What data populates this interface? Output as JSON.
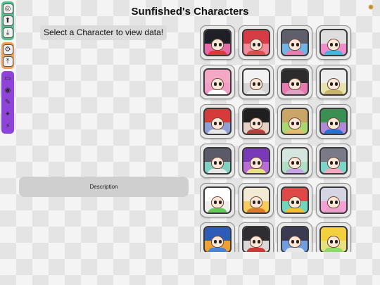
{
  "header": {
    "title": "Sunfished's Characters",
    "settings_icon": "gear-icon"
  },
  "prompt": {
    "text": "Select a Character to view data!"
  },
  "description": {
    "label": "Description"
  },
  "colors": {
    "toolbar_green": "#58bd8c",
    "toolbar_orange": "#f0a050",
    "toolbar_purple": "#8e44d8",
    "settings_gold": "#c48b20"
  },
  "toolbar": {
    "groups": [
      {
        "color": "toolbar_green",
        "items": [
          {
            "icon": "ring-icon",
            "glyph": "◎"
          },
          {
            "icon": "arrow-up-icon",
            "glyph": "⬆"
          },
          {
            "icon": "download-icon",
            "glyph": "⤓"
          }
        ]
      },
      {
        "color": "toolbar_orange",
        "items": [
          {
            "icon": "settings-icon",
            "glyph": "⚙"
          },
          {
            "icon": "up-icon",
            "glyph": "⤒"
          }
        ]
      },
      {
        "color": "toolbar_purple",
        "items": [
          {
            "icon": "frame-icon",
            "glyph": "▭"
          },
          {
            "icon": "color-icon",
            "glyph": "◉"
          },
          {
            "icon": "brush-icon",
            "glyph": "✎"
          },
          {
            "icon": "sparkle-icon",
            "glyph": "✦"
          },
          {
            "icon": "magic-icon",
            "glyph": "⚡"
          }
        ]
      }
    ]
  },
  "characters": [
    {
      "name": "character-1",
      "bg": "#e86aa8",
      "hair": "#1f1f27",
      "outfit": "#d93a3a"
    },
    {
      "name": "character-2",
      "bg": "#f28b9a",
      "hair": "#d73c45",
      "outfit": "#d65050"
    },
    {
      "name": "character-3",
      "bg": "#6fb5e8",
      "hair": "#5f5f6b",
      "outfit": "#e27fb0"
    },
    {
      "name": "character-4",
      "bg": "#f08ccc",
      "hair": "#dedede",
      "outfit": "#42b6d6"
    },
    {
      "name": "character-5",
      "bg": "#f39cc7",
      "hair": "#f5a8c6",
      "outfit": "#ffffff"
    },
    {
      "name": "character-6",
      "bg": "#d6d6d6",
      "hair": "#f2f2f2",
      "outfit": "#e8e8e8"
    },
    {
      "name": "character-7",
      "bg": "#e87aaf",
      "hair": "#2c2c2c",
      "outfit": "#e2a0c4"
    },
    {
      "name": "character-8",
      "bg": "#e7e3b0",
      "hair": "#ececec",
      "outfit": "#c8b36d"
    },
    {
      "name": "character-9",
      "bg": "#8ea0d6",
      "hair": "#d63a3a",
      "outfit": "#e8e8e8"
    },
    {
      "name": "character-10",
      "bg": "#e5d0c4",
      "hair": "#1f1f1f",
      "outfit": "#b44040"
    },
    {
      "name": "character-11",
      "bg": "#a8d86f",
      "hair": "#caa568",
      "outfit": "#e2bc77"
    },
    {
      "name": "character-12",
      "bg": "#b08ad8",
      "hair": "#3a8f52",
      "outfit": "#2c6ed0"
    },
    {
      "name": "character-13",
      "bg": "#7fd2c2",
      "hair": "#5a5a68",
      "outfit": "#e8e8e8"
    },
    {
      "name": "character-14",
      "bg": "#b86ed6",
      "hair": "#7a3ab8",
      "outfit": "#e8e080"
    },
    {
      "name": "character-15",
      "bg": "#b0e0c4",
      "hair": "#d4e6de",
      "outfit": "#c6a4e4"
    },
    {
      "name": "character-16",
      "bg": "#7ad6c8",
      "hair": "#7a7a88",
      "outfit": "#f4a8c0"
    },
    {
      "name": "character-17",
      "bg": "#eeeeee",
      "hair": "#ffffff",
      "outfit": "#67c75c"
    },
    {
      "name": "character-18",
      "bg": "#f7cc5a",
      "hair": "#f2ead2",
      "outfit": "#dd7a2a"
    },
    {
      "name": "character-19",
      "bg": "#6fd6c0",
      "hair": "#e04848",
      "outfit": "#f0c030"
    },
    {
      "name": "character-20",
      "bg": "#f2a0d6",
      "hair": "#d4d4e4",
      "outfit": "#e8a0c8"
    },
    {
      "name": "character-21",
      "bg": "#f0a030",
      "hair": "#2e5ab8",
      "outfit": "#4a84d8"
    },
    {
      "name": "character-22",
      "bg": "#d8d8d8",
      "hair": "#2e2e32",
      "outfit": "#c83a3a"
    },
    {
      "name": "character-23",
      "bg": "#6f9ee0",
      "hair": "#3a3a52",
      "outfit": "#e8e8e8"
    },
    {
      "name": "character-24",
      "bg": "#e6e080",
      "hair": "#f4d03e",
      "outfit": "#8ed86a"
    }
  ]
}
